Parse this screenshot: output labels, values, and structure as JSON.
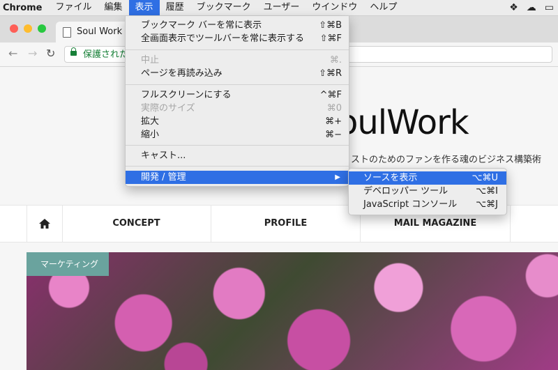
{
  "menubar": {
    "app": "Chrome",
    "items": [
      "ファイル",
      "編集",
      "表示",
      "履歴",
      "ブックマーク",
      "ユーザー",
      "ウインドウ",
      "ヘルプ"
    ],
    "active_index": 2
  },
  "browser": {
    "tab_title": "Soul Work 起",
    "address_prefix": "保護された"
  },
  "view_menu": {
    "items": [
      {
        "label": "ブックマーク バーを常に表示",
        "shortcut": "⇧⌘B",
        "enabled": true
      },
      {
        "label": "全画面表示でツールバーを常に表示する",
        "shortcut": "⇧⌘F",
        "enabled": true
      },
      {
        "label": "中止",
        "shortcut": "⌘.",
        "enabled": false
      },
      {
        "label": "ページを再読み込み",
        "shortcut": "⇧⌘R",
        "enabled": true
      },
      {
        "label": "フルスクリーンにする",
        "shortcut": "^⌘F",
        "enabled": true
      },
      {
        "label": "実際のサイズ",
        "shortcut": "⌘0",
        "enabled": false
      },
      {
        "label": "拡大",
        "shortcut": "⌘+",
        "enabled": true
      },
      {
        "label": "縮小",
        "shortcut": "⌘−",
        "enabled": true
      },
      {
        "label": "キャスト...",
        "shortcut": "",
        "enabled": true
      },
      {
        "label": "開発 / 管理",
        "shortcut": "",
        "enabled": true,
        "highlighted": true,
        "submenu": true
      }
    ]
  },
  "dev_submenu": {
    "items": [
      {
        "label": "ソースを表示",
        "shortcut": "⌥⌘U",
        "highlighted": true
      },
      {
        "label": "デベロッパー ツール",
        "shortcut": "⌥⌘I"
      },
      {
        "label": "JavaScript コンソール",
        "shortcut": "⌥⌘J"
      }
    ]
  },
  "site": {
    "logo_text": "oulWork",
    "tagline": "ィストのためのファンを作る魂のビジネス構築術",
    "nav": [
      "CONCEPT",
      "PROFILE",
      "MAIL MAGAZINE"
    ],
    "category_badge": "マーケティング"
  },
  "colors": {
    "menu_highlight": "#2f6fe4",
    "badge": "#6aa39e",
    "secure_green": "#188038"
  }
}
